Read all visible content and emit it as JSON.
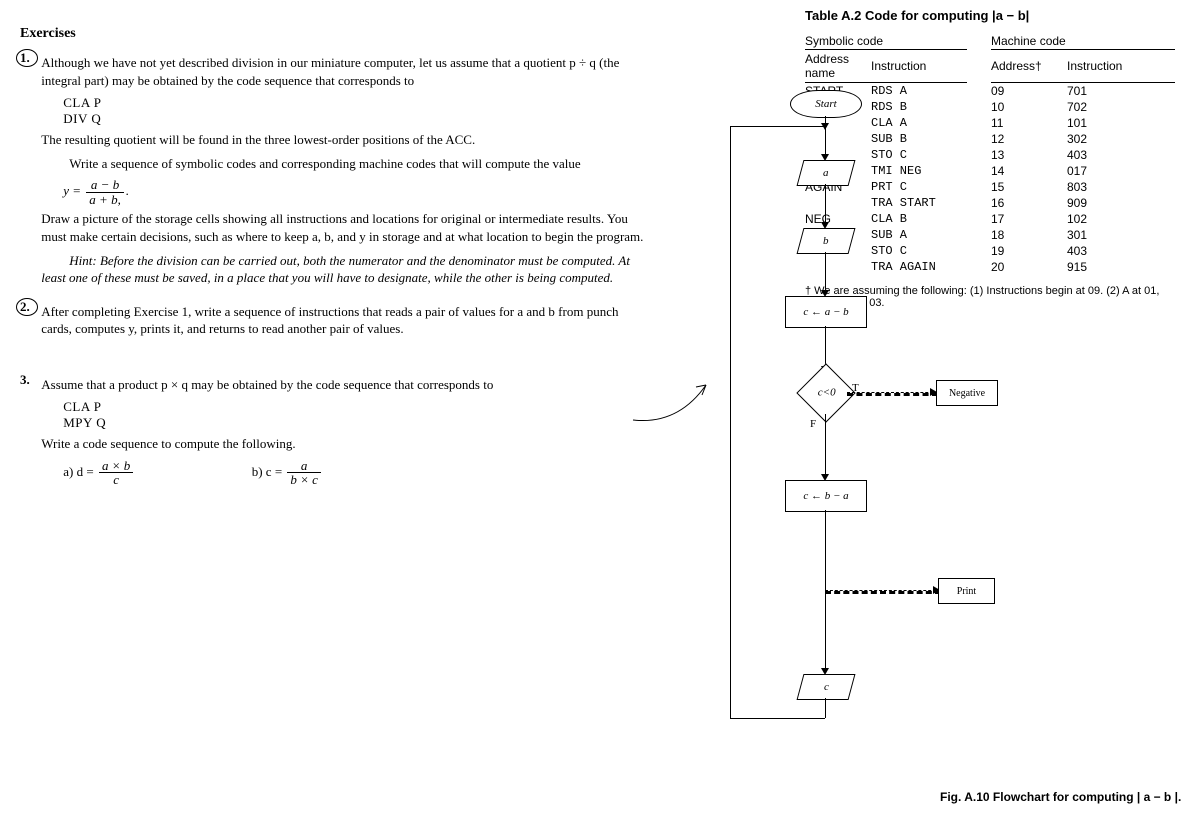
{
  "exercises_heading": "Exercises",
  "ex1": {
    "num": "1.",
    "p1": "Although we have not yet described division in our miniature computer, let us assume that a quotient p ÷ q (the integral part) may be obtained by the code sequence that corresponds to",
    "code1": "CLA P",
    "code2": "DIV Q",
    "p2": "The resulting quotient will be found in the three lowest-order positions of the ACC.",
    "p3": "Write a sequence of symbolic codes and corresponding machine codes that will compute the value",
    "frac_num": "a − b",
    "frac_den": "a + b,",
    "p4": "Draw a picture of the storage cells showing all instructions and locations for original or intermediate results. You must make certain decisions, such as where to keep a, b, and y in storage and at what location to begin the program.",
    "hint": "Hint: Before the division can be carried out, both the numerator and the denominator must be computed. At least one of these must be saved, in a place that you will have to designate, while the other is being computed."
  },
  "ex2": {
    "num": "2.",
    "p1": "After completing Exercise 1, write a sequence of instructions that reads a pair of values for a and b from punch cards, computes y, prints it, and returns to read another pair of values."
  },
  "ex3": {
    "num": "3.",
    "p1": "Assume that a product p × q may be obtained by the code sequence that corresponds to",
    "code1": "CLA P",
    "code2": "MPY Q",
    "p2": "Write a code sequence to compute the following.",
    "a_label": "a)  d =",
    "a_num": "a × b",
    "a_den": "c",
    "b_label": "b)  c =",
    "b_num": "a",
    "b_den": "b × c"
  },
  "table": {
    "title": "Table A.2 Code for computing |a − b|",
    "sym_hdr": "Symbolic code",
    "mach_hdr": "Machine code",
    "col_addrname": "Address name",
    "col_instr": "Instruction",
    "col_addr": "Address†",
    "rows": [
      {
        "name": "START",
        "instr": "RDS A",
        "addr": "09",
        "m": "701"
      },
      {
        "name": "",
        "instr": "RDS B",
        "addr": "10",
        "m": "702"
      },
      {
        "name": "",
        "instr": "CLA A",
        "addr": "11",
        "m": "101"
      },
      {
        "name": "",
        "instr": "SUB B",
        "addr": "12",
        "m": "302"
      },
      {
        "name": "",
        "instr": "STO C",
        "addr": "13",
        "m": "403"
      },
      {
        "name": "",
        "instr": "TMI NEG",
        "addr": "14",
        "m": "017"
      },
      {
        "name": "AGAIN",
        "instr": "PRT C",
        "addr": "15",
        "m": "803"
      },
      {
        "name": "",
        "instr": "TRA START",
        "addr": "16",
        "m": "909"
      },
      {
        "name": "NEG",
        "instr": "CLA B",
        "addr": "17",
        "m": "102"
      },
      {
        "name": "",
        "instr": "SUB A",
        "addr": "18",
        "m": "301"
      },
      {
        "name": "",
        "instr": "STO C",
        "addr": "19",
        "m": "403"
      },
      {
        "name": "",
        "instr": "TRA AGAIN",
        "addr": "20",
        "m": "915"
      }
    ],
    "footnote": "† We are assuming the following: (1) Instructions begin at 09. (2) A at 01, B at 02, C at 03."
  },
  "flow": {
    "start": "Start",
    "a": "a",
    "b": "b",
    "cab": "c ← a − b",
    "test": "c<0",
    "T": "T",
    "F": "F",
    "cba": "c ← b − a",
    "print": "Print",
    "neg": "Negative",
    "c": "c"
  },
  "fig_caption": "Fig. A.10 Flowchart for computing | a − b |."
}
